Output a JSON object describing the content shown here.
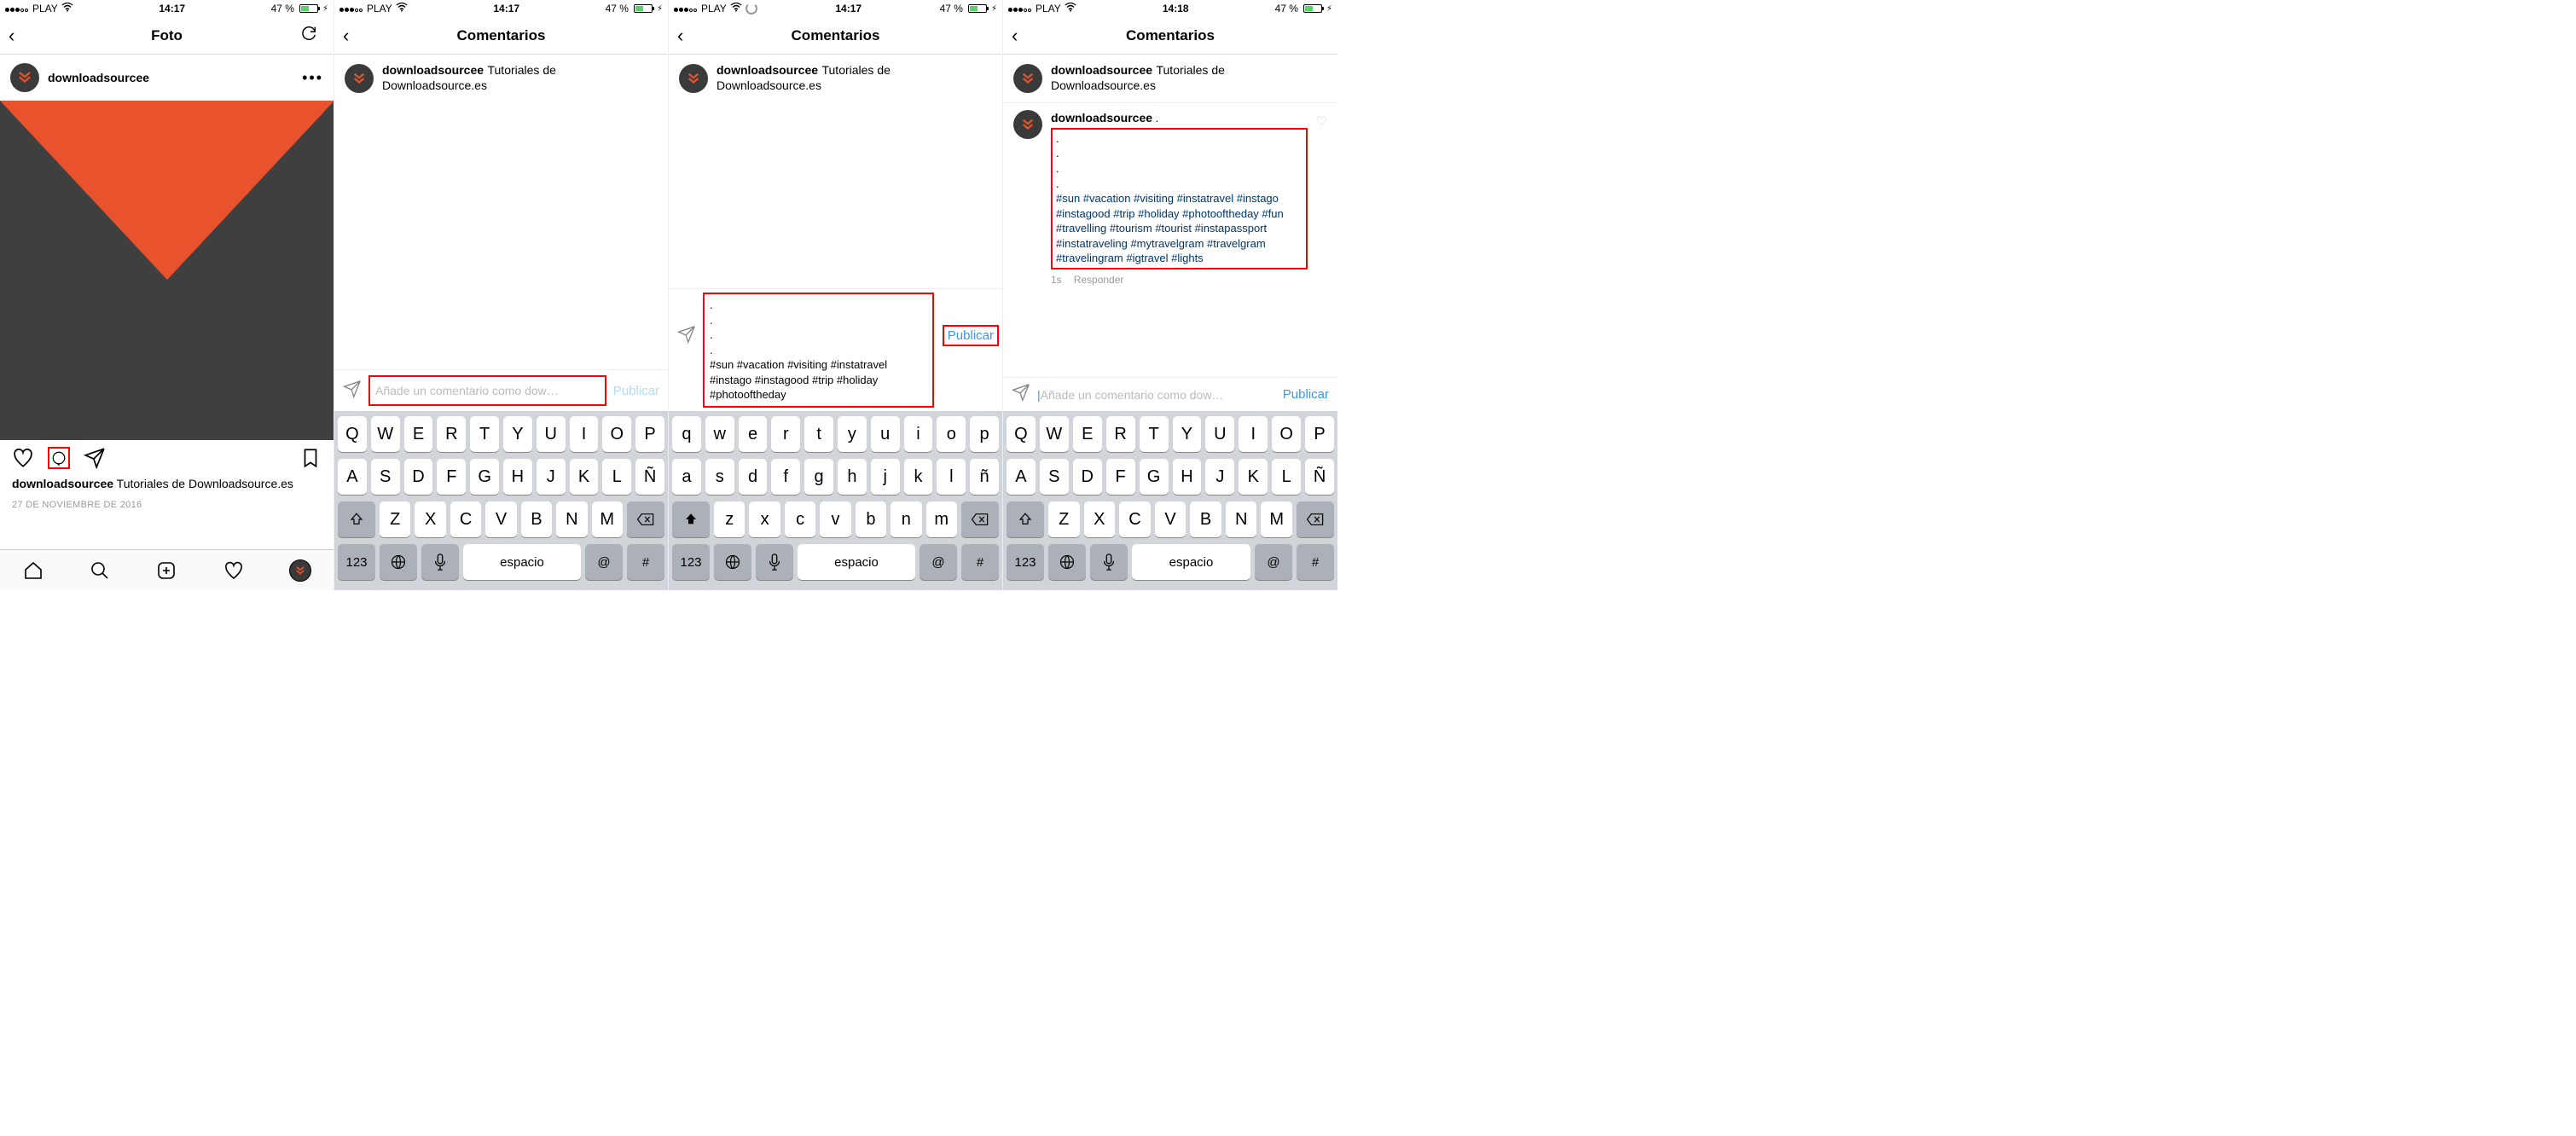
{
  "status": {
    "carrier": "PLAY",
    "time1": "14:17",
    "time4": "14:18",
    "battery": "47 %"
  },
  "s1": {
    "title": "Foto",
    "username": "downloadsourcee",
    "caption_user": "downloadsourcee",
    "caption_text": "Tutoriales de Downloadsource.es",
    "date": "27 DE NOVIEMBRE DE 2016"
  },
  "s2": {
    "title": "Comentarios",
    "username": "downloadsourcee",
    "caption": "Tutoriales de Downloadsource.es",
    "placeholder": "Añade un comentario como dow…",
    "publish": "Publicar"
  },
  "s3": {
    "title": "Comentarios",
    "username": "downloadsourcee",
    "caption": "Tutoriales de Downloadsource.es",
    "draft_dots": ".\n.\n.\n.",
    "draft_tags": "#sun #vacation #visiting #instatravel #instago #instagood #trip #holiday #photooftheday",
    "publish": "Publicar"
  },
  "s4": {
    "title": "Comentarios",
    "username": "downloadsourcee",
    "caption": "Tutoriales de Downloadsource.es",
    "comment_user": "downloadsourcee",
    "comment_lead": " .",
    "comment_dots": ".\n.\n.\n.",
    "comment_tags": "#sun #vacation #visiting #instatravel #instago #instagood #trip #holiday #photooftheday #fun #travelling #tourism #tourist #instapassport #instatraveling #mytravelgram #travelgram #travelingram #igtravel #lights",
    "time": "1s",
    "reply": "Responder",
    "placeholder": "Añade un comentario como dow…",
    "publish": "Publicar"
  },
  "kb": {
    "r1u": [
      "Q",
      "W",
      "E",
      "R",
      "T",
      "Y",
      "U",
      "I",
      "O",
      "P"
    ],
    "r1l": [
      "q",
      "w",
      "e",
      "r",
      "t",
      "y",
      "u",
      "i",
      "o",
      "p"
    ],
    "r2u": [
      "A",
      "S",
      "D",
      "F",
      "G",
      "H",
      "J",
      "K",
      "L",
      "Ñ"
    ],
    "r2l": [
      "a",
      "s",
      "d",
      "f",
      "g",
      "h",
      "j",
      "k",
      "l",
      "ñ"
    ],
    "r3u": [
      "Z",
      "X",
      "C",
      "V",
      "B",
      "N",
      "M"
    ],
    "r3l": [
      "z",
      "x",
      "c",
      "v",
      "b",
      "n",
      "m"
    ],
    "num": "123",
    "space": "espacio",
    "at": "@",
    "hash": "#"
  }
}
